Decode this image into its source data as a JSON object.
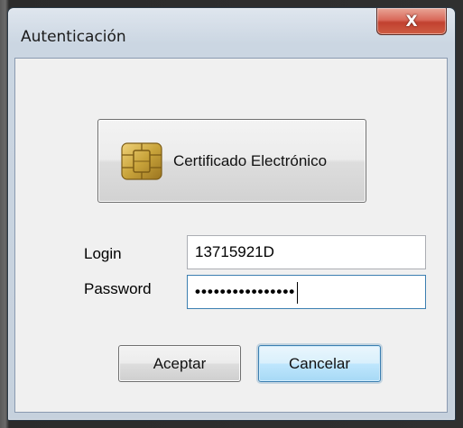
{
  "window": {
    "title": "Autenticación",
    "close_label": "X"
  },
  "certificate_button": {
    "label": "Certificado Electrónico",
    "icon": "smartcard-chip-icon"
  },
  "login": {
    "label": "Login",
    "value": "13715921D"
  },
  "password": {
    "label": "Password",
    "masked_value": "••••••••••••••••"
  },
  "buttons": {
    "accept": "Aceptar",
    "cancel": "Cancelar"
  },
  "colors": {
    "close_button": "#c1412f",
    "default_button_border": "#3c7fb1",
    "chip": "#c9a43b"
  }
}
